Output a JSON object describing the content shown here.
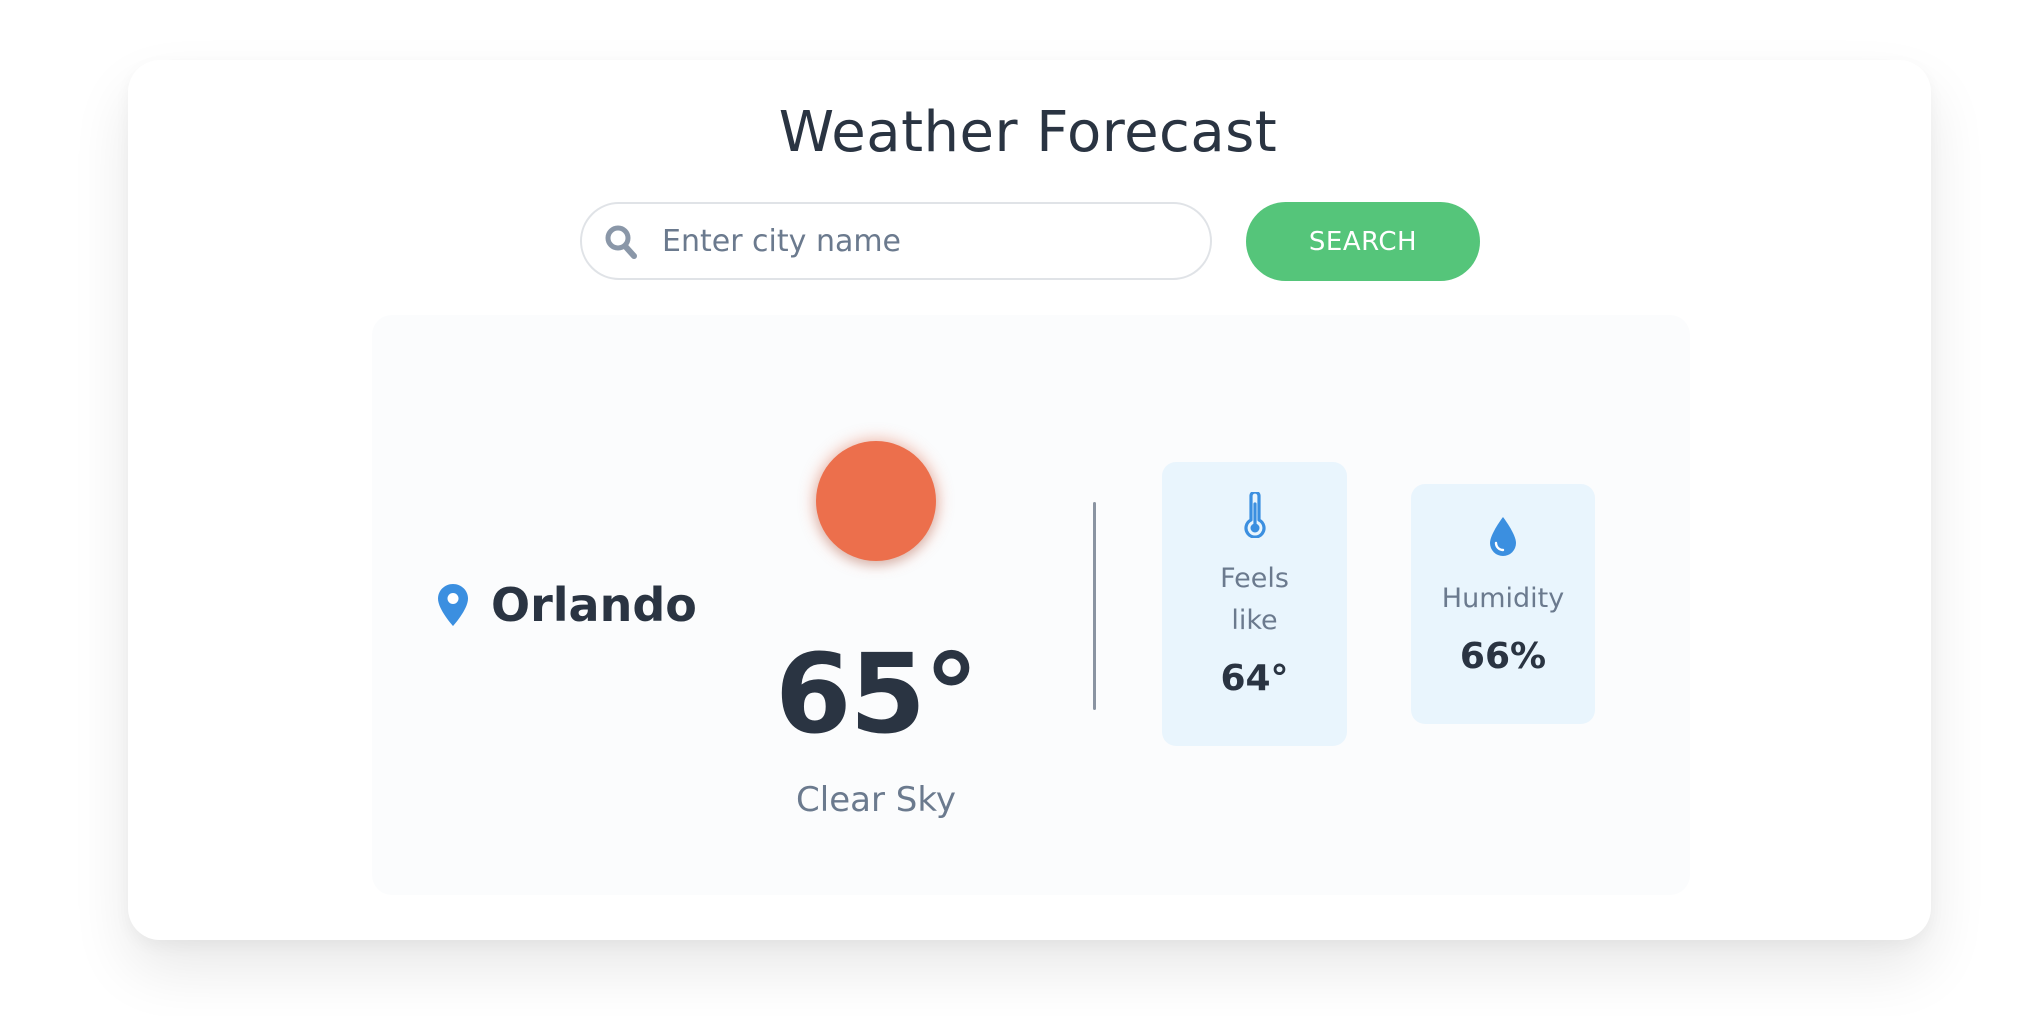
{
  "header": {
    "title": "Weather Forecast"
  },
  "search": {
    "placeholder": "Enter city name",
    "value": "",
    "button_label": "SEARCH"
  },
  "current": {
    "city": "Orlando",
    "temperature": "65°",
    "condition": "Clear Sky",
    "condition_icon": "sun-icon"
  },
  "stats": {
    "feels_like": {
      "label_line1": "Feels",
      "label_line2": "like",
      "value": "64°",
      "icon": "thermometer-icon"
    },
    "humidity": {
      "label": "Humidity",
      "value": "66%",
      "icon": "water-drop-icon"
    }
  },
  "colors": {
    "accent": "#55c57a",
    "icon_blue": "#3b8fe0",
    "sun": "#ec6f4c",
    "stat_bg": "#e9f5fd",
    "text_dark": "#2a3442",
    "text_muted": "#6b7a8e"
  }
}
